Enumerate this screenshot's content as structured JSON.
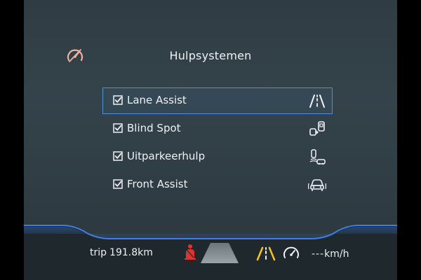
{
  "header": {
    "title": "Hulpsystemen",
    "icon": "assist-off-gauge-icon",
    "icon_color": "#f2b0a0"
  },
  "menu": {
    "selected_index": 0,
    "items": [
      {
        "label": "Lane Assist",
        "checked": true,
        "icon": "lane-assist-icon"
      },
      {
        "label": "Blind Spot",
        "checked": true,
        "icon": "blind-spot-icon"
      },
      {
        "label": "Uitparkeerhulp",
        "checked": true,
        "icon": "rear-traffic-alert-icon"
      },
      {
        "label": "Front Assist",
        "checked": true,
        "icon": "front-assist-icon"
      }
    ]
  },
  "status_bar": {
    "trip_label": "trip",
    "trip_value": "191.8km",
    "speed_value": "---",
    "speed_unit": "km/h",
    "icons": [
      "seatbelt-warning-icon",
      "road-icon",
      "lane-assist-status-icon",
      "speed-limiter-icon"
    ]
  },
  "colors": {
    "selection_border": "#4f8fd8",
    "accent_blue": "#3d7fe0",
    "warning_red": "#e53030",
    "lane_yellow": "#f2c21a",
    "text": "#eef1f3"
  }
}
